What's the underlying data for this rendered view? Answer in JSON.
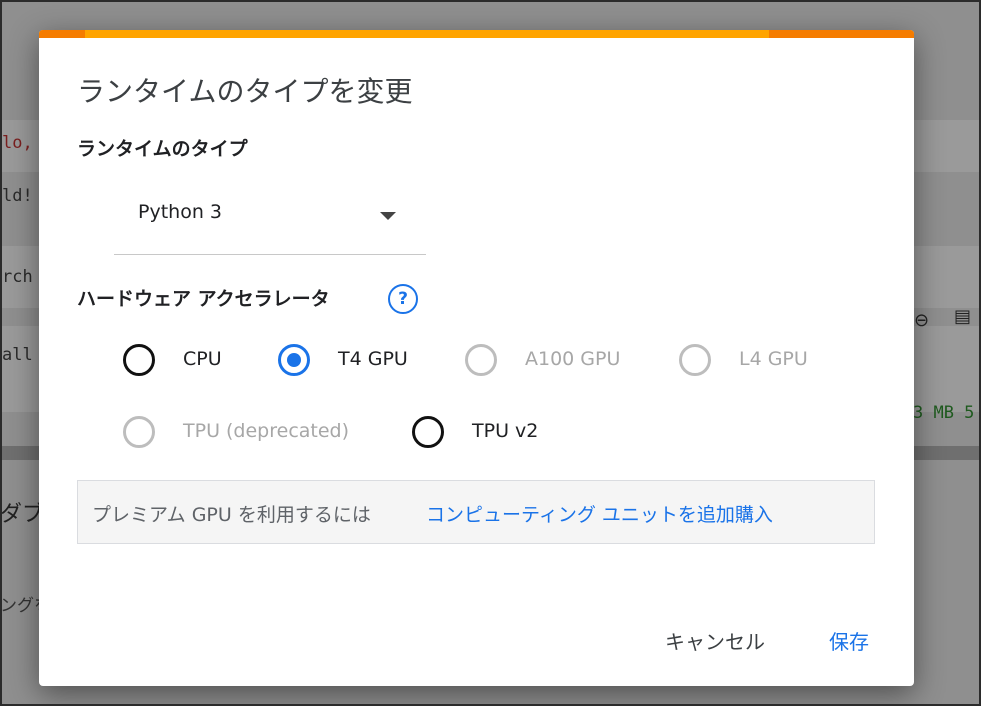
{
  "background": {
    "code_lines": [
      "lo,",
      "ld!",
      "rch",
      "all"
    ],
    "output_line": "3 MB 5",
    "side_text_1": "ダブ",
    "side_text_2": "ングを"
  },
  "dialog": {
    "title": "ランタイムのタイプを変更",
    "runtime_type_label": "ランタイムのタイプ",
    "runtime_select_value": "Python 3",
    "hardware_label": "ハードウェア アクセラレータ",
    "help_icon_glyph": "?",
    "accelerators": [
      {
        "label": "CPU",
        "selected": false,
        "enabled": true
      },
      {
        "label": "T4 GPU",
        "selected": true,
        "enabled": true
      },
      {
        "label": "A100 GPU",
        "selected": false,
        "enabled": false
      },
      {
        "label": "L4 GPU",
        "selected": false,
        "enabled": false
      },
      {
        "label": "TPU (deprecated)",
        "selected": false,
        "enabled": false
      },
      {
        "label": "TPU v2",
        "selected": false,
        "enabled": true
      }
    ],
    "premium_text": "プレミアム GPU を利用するには",
    "premium_link": "コンピューティング ユニットを追加購入",
    "cancel_label": "キャンセル",
    "save_label": "保存"
  },
  "colors": {
    "accent": "#1a73e8",
    "progress_bar": "#ffa400",
    "progress_bar_dark": "#f57c00"
  }
}
